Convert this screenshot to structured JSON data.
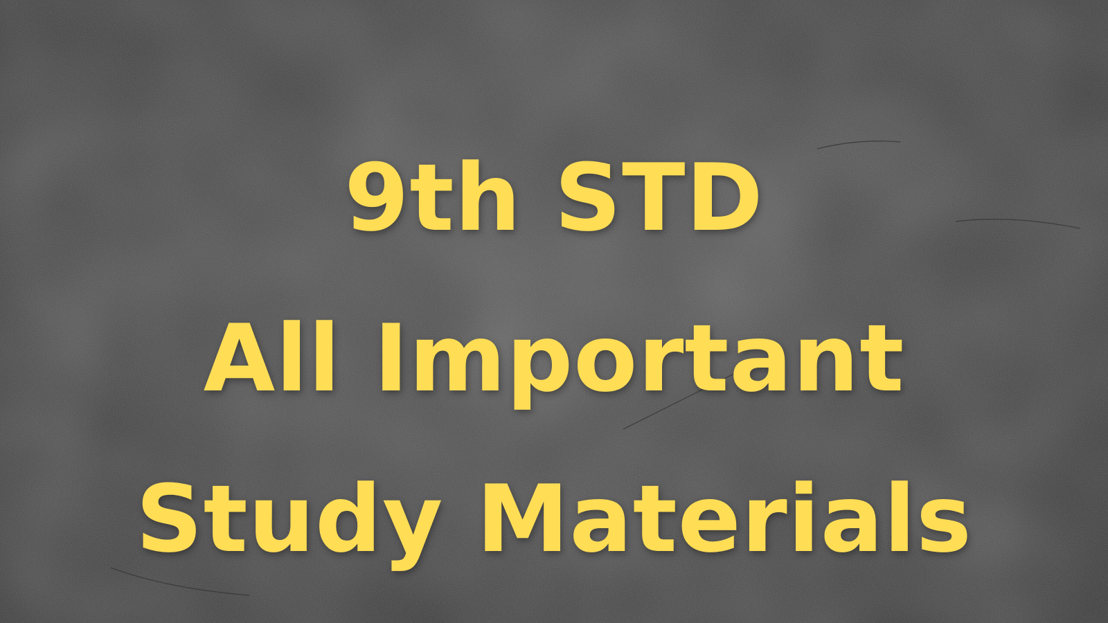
{
  "banner": {
    "lines": [
      "9th STD",
      "All Important",
      "Study Materials"
    ],
    "text_color": "#FFDD55",
    "background_color": "#464646"
  }
}
